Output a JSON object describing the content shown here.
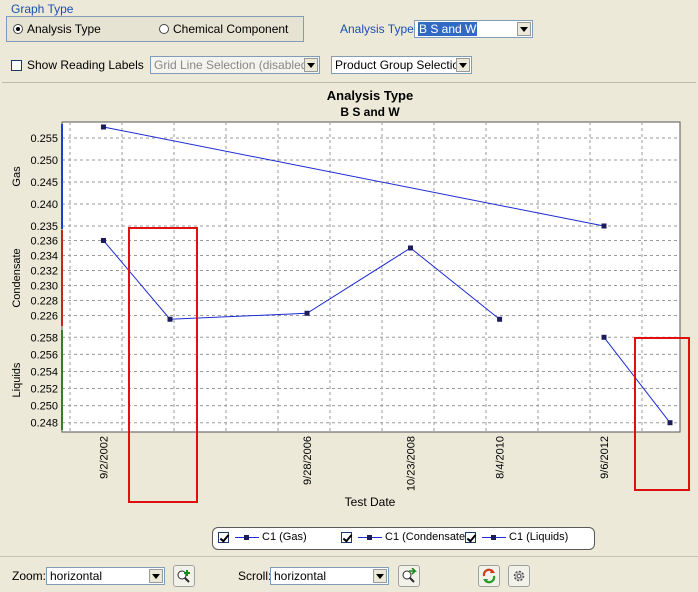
{
  "graph_type": {
    "title": "Graph Type",
    "options": [
      {
        "label": "Analysis Type",
        "selected": true
      },
      {
        "label": "Chemical Component",
        "selected": false
      }
    ]
  },
  "analysis_type": {
    "label": "Analysis Type:",
    "value": "B S and W"
  },
  "toolbar": {
    "show_reading_labels": {
      "label": "Show Reading Labels",
      "checked": false
    },
    "grid_line_selection": "Grid Line Selection (disabled)",
    "product_group_selection": "Product Group Selection"
  },
  "chart_data": {
    "type": "line",
    "title": "Analysis Type",
    "subtitle": "B S and W",
    "xlabel": "Test Date",
    "x_ticks": [
      "9/2/2002",
      "9/28/2006",
      "10/23/2008",
      "8/4/2010",
      "9/6/2012"
    ],
    "panels": [
      {
        "ylabel": "Gas",
        "ylim": [
          0.235,
          0.2575
        ],
        "yticks": [
          "0.255",
          "0.250",
          "0.245",
          "0.240",
          "0.235"
        ],
        "color": "#1c3fd0"
      },
      {
        "ylabel": "Condensate",
        "ylim": [
          0.225,
          0.237
        ],
        "yticks": [
          "0.236",
          "0.234",
          "0.232",
          "0.230",
          "0.228",
          "0.226"
        ],
        "color": "#c0281c"
      },
      {
        "ylabel": "Liquids",
        "ylim": [
          0.2475,
          0.2585
        ],
        "yticks": [
          "0.258",
          "0.256",
          "0.254",
          "0.252",
          "0.250",
          "0.248"
        ],
        "color": "#3a7a2a"
      }
    ],
    "series": [
      {
        "name": "C1 (Gas)",
        "panel": 0,
        "x": [
          "9/2/2002",
          "9/6/2012"
        ],
        "values": [
          0.2575,
          0.235
        ]
      },
      {
        "name": "C1 (Condensate)",
        "panel": 1,
        "x": [
          "9/2/2002",
          "2004",
          "9/28/2006",
          "10/23/2008",
          "8/4/2010"
        ],
        "values": [
          0.236,
          0.2255,
          0.2263,
          0.235,
          0.2255
        ]
      },
      {
        "name": "C1 (Liquids)",
        "panel": 2,
        "x": [
          "9/6/2012",
          "2014"
        ],
        "values": [
          0.258,
          0.248
        ]
      }
    ],
    "grid": true,
    "legend": "bottom"
  },
  "legend_items": [
    {
      "label": "C1 (Gas)",
      "checked": true
    },
    {
      "label": "C1 (Condensate)",
      "checked": true
    },
    {
      "label": "C1 (Liquids)",
      "checked": true
    }
  ],
  "bottom_bar": {
    "zoom_label": "Zoom:",
    "zoom_value": "horizontal",
    "scroll_label": "Scroll:",
    "scroll_value": "horizontal"
  }
}
